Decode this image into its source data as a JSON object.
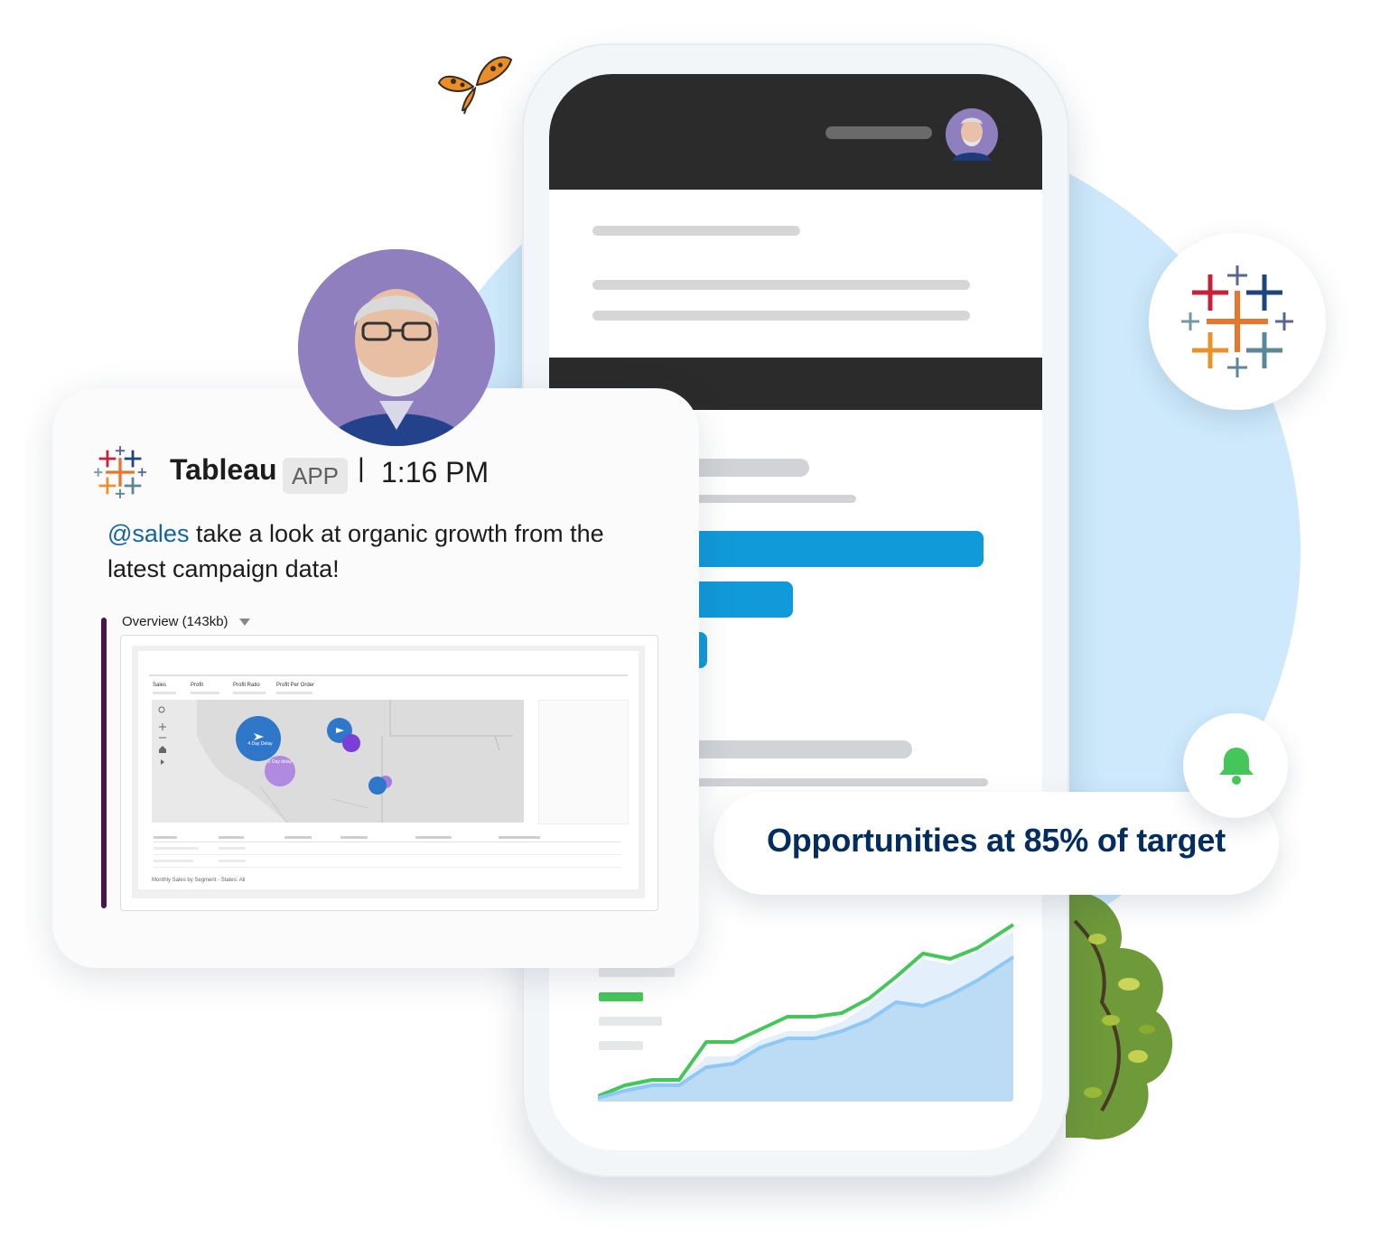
{
  "slack_message": {
    "app_name": "Tableau",
    "app_badge": "APP",
    "separator": "|",
    "time": "1:16 PM",
    "mention": "@sales",
    "text": " take a look at organic growth from the latest campaign data!",
    "attachment": {
      "title": "Overview (143kb)",
      "dashboard": {
        "kpis": [
          "Sales",
          "Profit",
          "Profit Ratio",
          "Profit Per Order"
        ],
        "bubbles": [
          "4 Day Delay",
          "2 Day delay"
        ],
        "footer": "Monthly Sales by Segment - States: All"
      }
    }
  },
  "notification": {
    "text": "Opportunities at 85% of target",
    "icon": "bell-icon"
  },
  "icons": {
    "brand_logo": "tableau-logo-icon",
    "decoration": "butterfly-icon"
  },
  "colors": {
    "brand_navy": "#032d60",
    "mention_blue": "#1264a3",
    "phone_bar_blue": "#119ad9",
    "chart_green": "#45c65a",
    "chart_blue": "#8fc8f4",
    "bell_green": "#45c65a"
  }
}
